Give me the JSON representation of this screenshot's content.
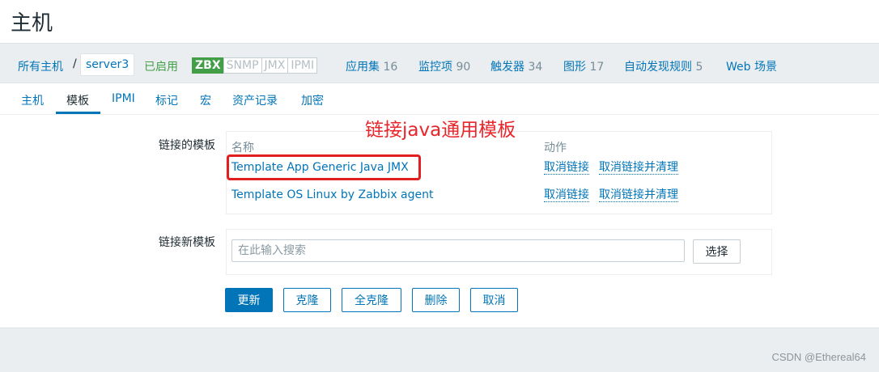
{
  "page": {
    "title": "主机"
  },
  "breadcrumb": {
    "all_hosts": "所有主机",
    "separator": "/",
    "current_host": "server3"
  },
  "status": {
    "enabled": "已启用"
  },
  "interfaces": [
    {
      "label": "ZBX",
      "active": true
    },
    {
      "label": "SNMP",
      "active": false
    },
    {
      "label": "JMX",
      "active": false
    },
    {
      "label": "IPMI",
      "active": false
    }
  ],
  "host_links": [
    {
      "label": "应用集",
      "count": "16"
    },
    {
      "label": "监控项",
      "count": "90"
    },
    {
      "label": "触发器",
      "count": "34"
    },
    {
      "label": "图形",
      "count": "17"
    },
    {
      "label": "自动发现规则",
      "count": "5"
    },
    {
      "label": "Web 场景",
      "count": ""
    }
  ],
  "tabs": [
    {
      "label": "主机",
      "active": false
    },
    {
      "label": "模板",
      "active": true
    },
    {
      "label": "IPMI",
      "active": false
    },
    {
      "label": "标记",
      "active": false
    },
    {
      "label": "宏",
      "active": false
    },
    {
      "label": "资产记录",
      "active": false
    },
    {
      "label": "加密",
      "active": false
    }
  ],
  "linked_templates": {
    "label": "链接的模板",
    "col_name": "名称",
    "col_action": "动作",
    "rows": [
      {
        "name": "Template App Generic Java JMX",
        "unlink": "取消链接",
        "unlink_clear": "取消链接并清理"
      },
      {
        "name": "Template OS Linux by Zabbix agent",
        "unlink": "取消链接",
        "unlink_clear": "取消链接并清理"
      }
    ]
  },
  "annotation": "链接java通用模板",
  "new_templates": {
    "label": "链接新模板",
    "search_placeholder": "在此输入搜索",
    "select_button": "选择"
  },
  "actions": {
    "update": "更新",
    "clone": "克隆",
    "full_clone": "全克隆",
    "delete": "删除",
    "cancel": "取消"
  },
  "watermark": "CSDN @Ethereal64",
  "colors": {
    "accent": "#0275b8",
    "enabled_green": "#429e47",
    "annotation_red": "#e8262b"
  }
}
